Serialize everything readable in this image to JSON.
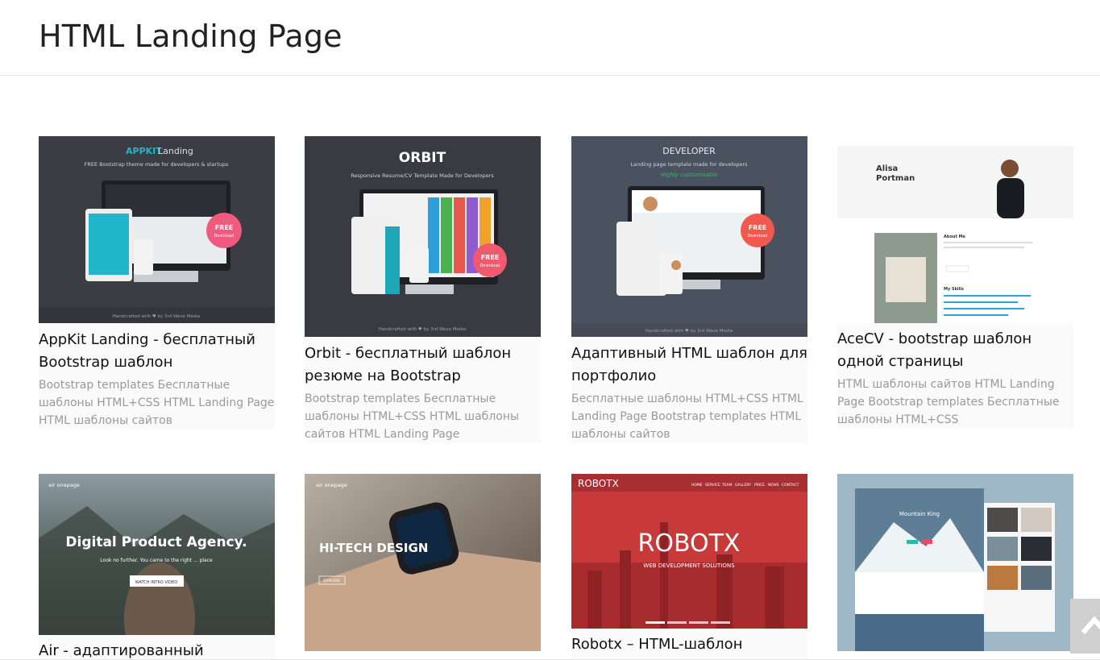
{
  "page": {
    "title": "HTML Landing Page"
  },
  "cards": [
    {
      "title": "AppKit Landing - бесплатный Bootstrap шаблон",
      "tags": "Bootstrap templates Бесплатные шаблоны HTML+CSS HTML Landing Page HTML шаблоны сайтов",
      "thumb": {
        "brand": "APPKIT",
        "brand2": "Landing",
        "subtitle": "FREE Bootstrap theme made for developers & startups",
        "badge": "FREE",
        "badge_sub": "Download",
        "footer": "Handcrafted with ♥ by 3rd Wave Media",
        "bg": "#3c3d44",
        "accent": "#1fb7c9",
        "badge_color": "#f05a7e"
      }
    },
    {
      "title": "Orbit - бесплатный шаблон резюме на Bootstrap",
      "tags": "Bootstrap templates Бесплатные шаблоны HTML+CSS HTML шаблоны сайтов HTML Landing Page",
      "thumb": {
        "brand": "ORBIT",
        "subtitle": "Responsive Resume/CV Template Made for Developers",
        "badge": "FREE",
        "badge_sub": "Download",
        "footer": "Handcrafted with ♥ by 3rd Wave Media",
        "bg": "#3a3b42",
        "accent": "#1fb7c9",
        "badge_color": "#f05a6e"
      }
    },
    {
      "title": "Адаптивный HTML шаблон для портфолио",
      "tags": "Бесплатные шаблоны HTML+CSS HTML Landing Page Bootstrap templates HTML шаблоны сайтов",
      "thumb": {
        "brand": "DEVELOPER",
        "subtitle": "Landing page template made for developers",
        "tagline": "Highly customisable",
        "badge": "FREE",
        "badge_sub": "Download",
        "footer": "Handcrafted with ♥ by 3rd Wave Media",
        "bg": "#4a5260",
        "accent": "#3fb36a",
        "badge_color": "#f05a4e"
      }
    },
    {
      "title": "AceCV - bootstrap шаблон одной страницы",
      "tags": "HTML шаблоны сайтов HTML Landing Page Bootstrap templates Бесплатные шаблоны HTML+CSS",
      "thumb": {
        "name1": "Alisa",
        "name2": "Portman",
        "section1": "About Me",
        "section2": "My Skills",
        "bg": "#f7f7f7",
        "accent": "#2aa7d8"
      }
    },
    {
      "title": "Air - адаптированный bootstrap",
      "tags": "",
      "thumb": {
        "brand": "air onepage",
        "headline": "Digital Product Agency.",
        "sub": "Look no further. You came to the right ... place",
        "button": "WATCH INTRO VIDEO",
        "bg": "#5d6b74"
      }
    },
    {
      "title": "",
      "tags": "",
      "thumb": {
        "brand": "air onepage",
        "headline": "HI-TECH DESIGN",
        "button": "EXPLORE",
        "bg": "#8d8176"
      }
    },
    {
      "title": "Robotx – HTML-шаблон",
      "tags": "",
      "thumb": {
        "brand": "ROBOTX",
        "headline": "ROBOTX",
        "sub": "WEB DEVELOPMENT SOLUTIONS",
        "menu": [
          "HOME",
          "SERVICE",
          "TEAM",
          "GALLERY",
          "PRICE",
          "NEWS",
          "CONTACT"
        ],
        "bg": "#c8393a"
      }
    },
    {
      "title": "",
      "tags": "",
      "thumb": {
        "headline": "Mountain King",
        "bg": "#9fb8c7"
      }
    }
  ],
  "ui": {
    "scroll_top_icon": "chevron-up-icon"
  }
}
